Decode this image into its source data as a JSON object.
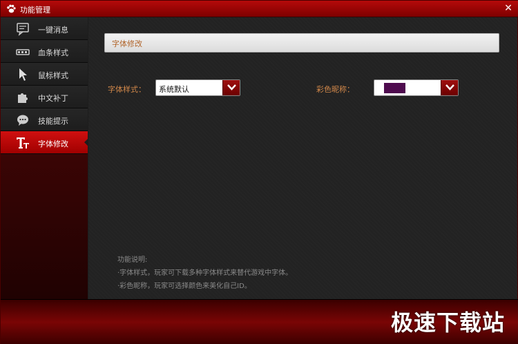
{
  "window": {
    "title": "功能管理",
    "close_glyph": "✕"
  },
  "sidebar": {
    "items": [
      {
        "label": "一键消息",
        "icon": "chat-bubble-icon"
      },
      {
        "label": "血条样式",
        "icon": "health-bar-icon"
      },
      {
        "label": "鼠标样式",
        "icon": "mouse-cursor-icon"
      },
      {
        "label": "中文补丁",
        "icon": "puzzle-piece-icon"
      },
      {
        "label": "技能提示",
        "icon": "speech-dots-icon"
      },
      {
        "label": "字体修改",
        "icon": "font-icon",
        "active": true
      }
    ]
  },
  "main": {
    "section_title": "字体修改",
    "font_style": {
      "label": "字体样式：",
      "value": "系统默认"
    },
    "color_nick": {
      "label": "彩色昵称：",
      "swatch_color": "#4e0b4e"
    },
    "description": {
      "heading": "功能说明:",
      "lines": [
        "·字体样式，玩家可下载多种字体样式来替代游戏中字体。",
        "·彩色昵称，玩家可选择颜色来美化自己ID。"
      ]
    }
  },
  "footer": {
    "watermark": "极速下载站"
  },
  "colors": {
    "accent": "#a00000",
    "label_orange": "#d2884a"
  }
}
